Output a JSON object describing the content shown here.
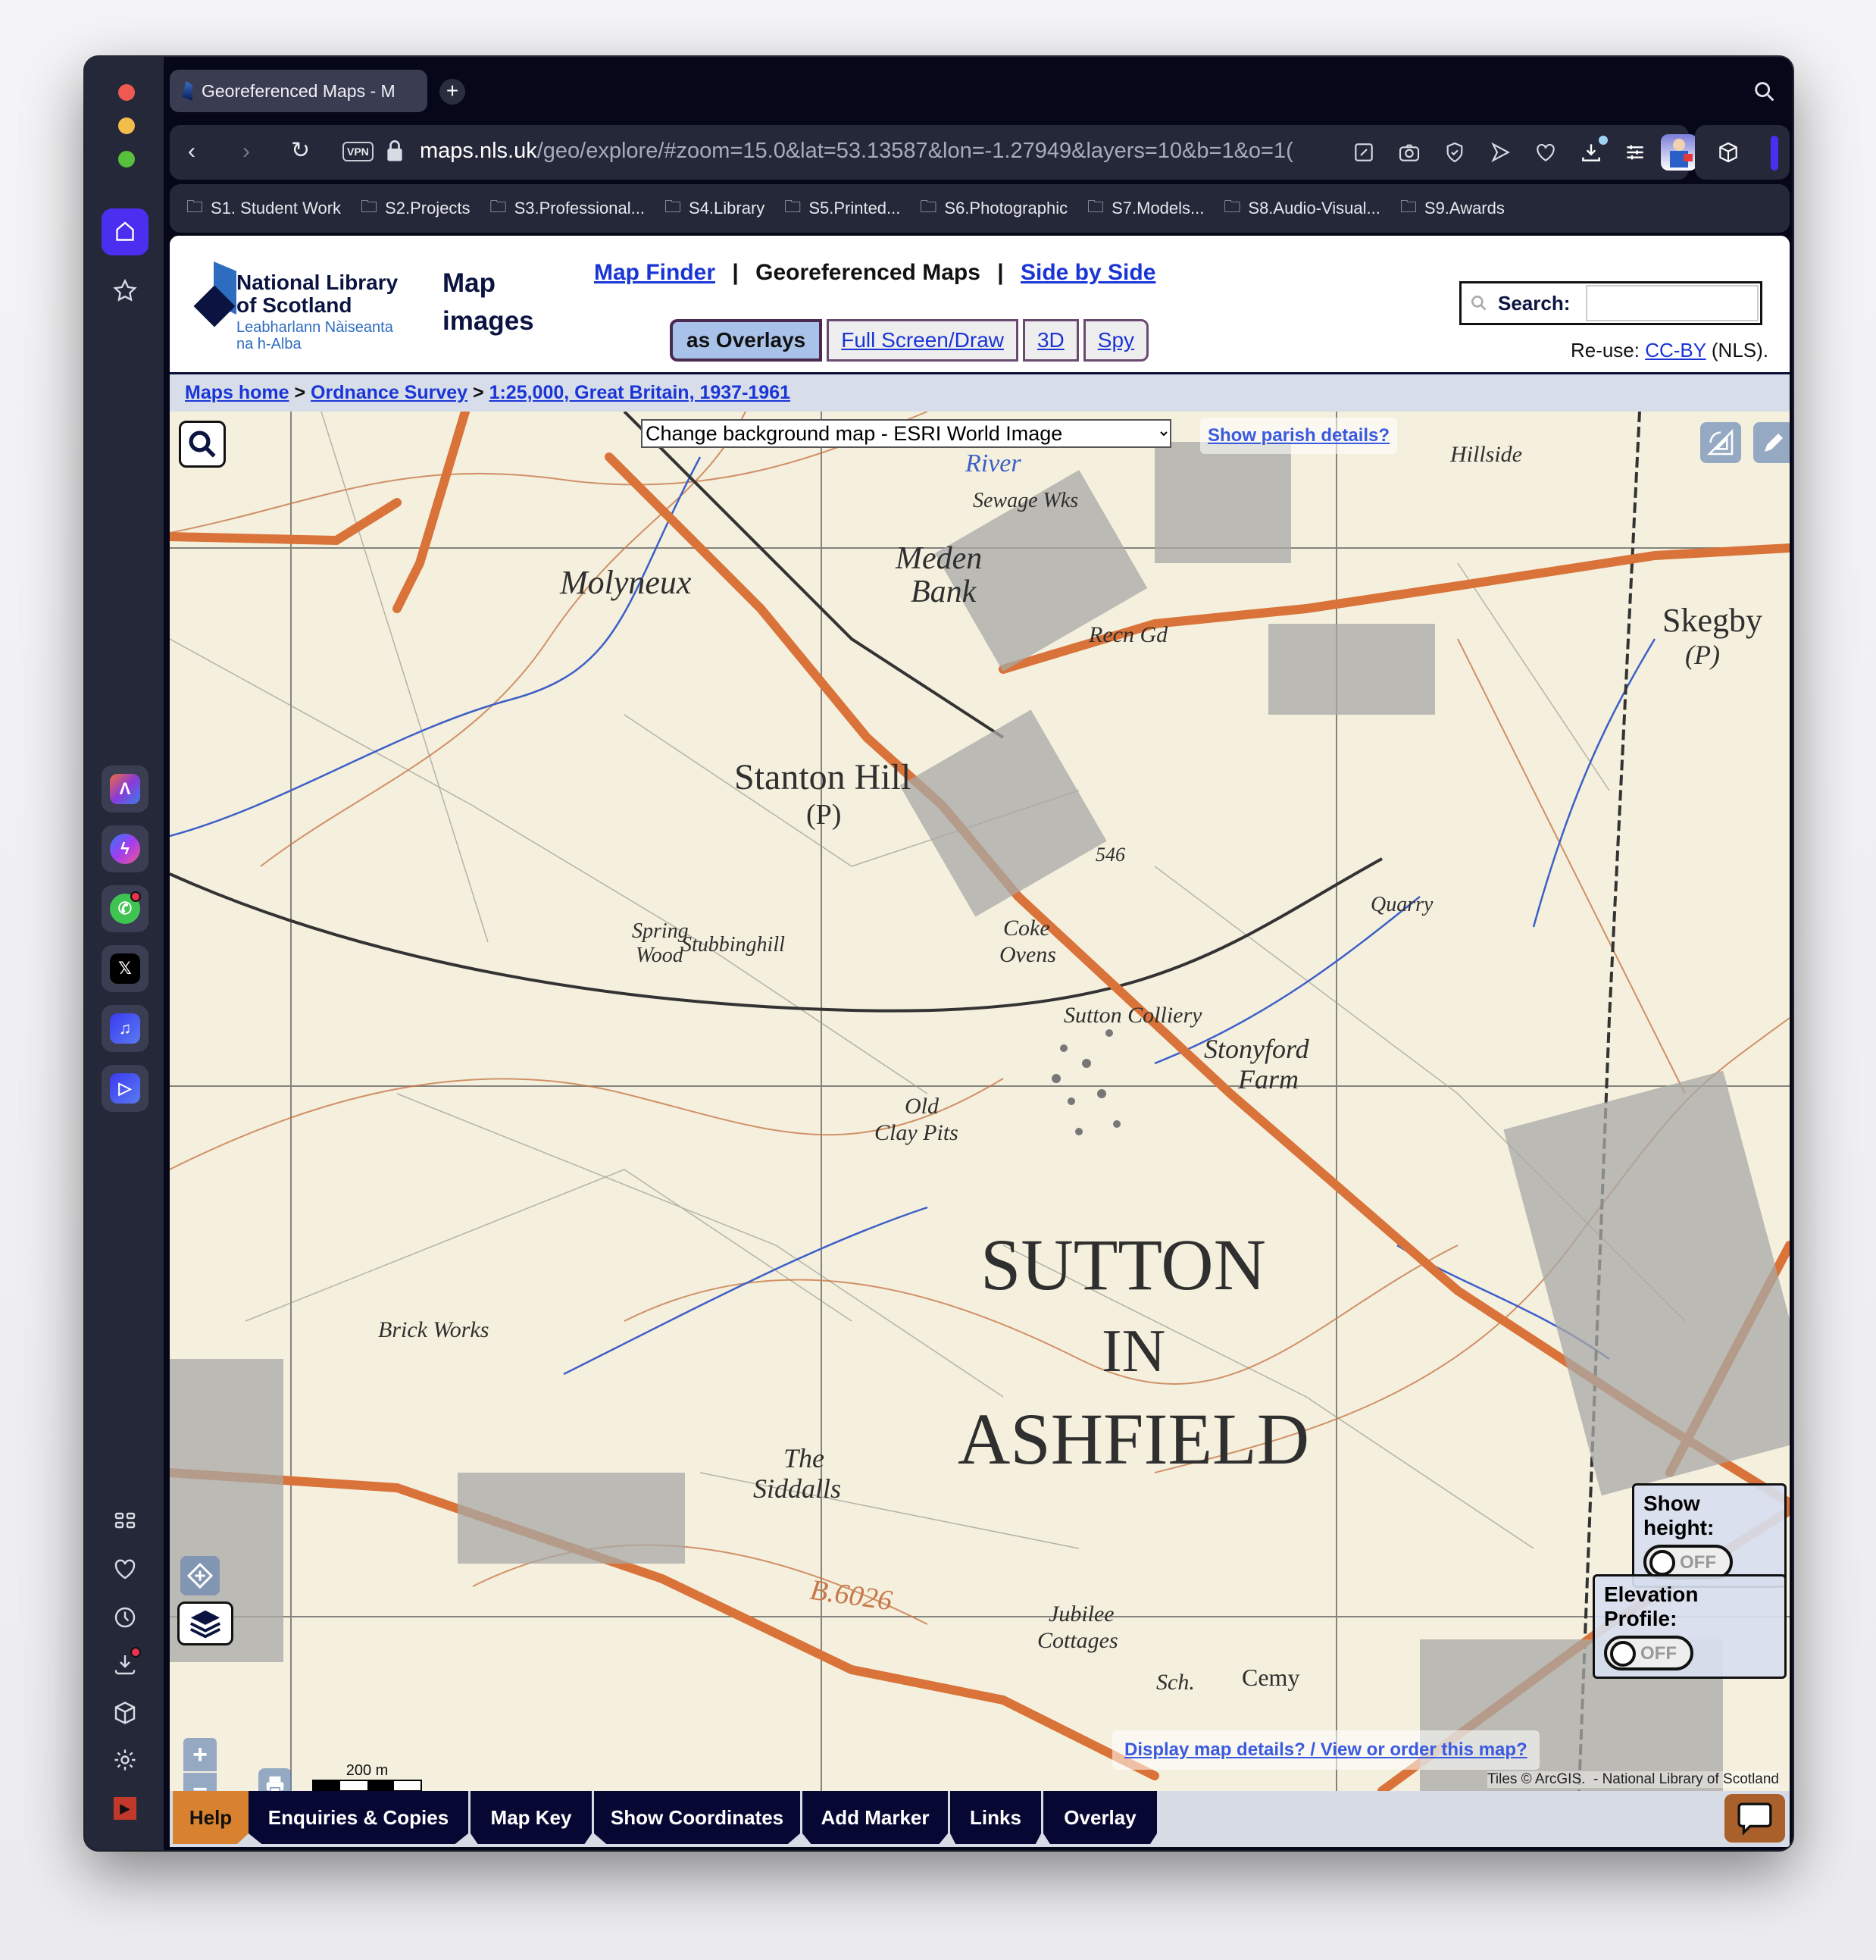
{
  "browser": {
    "tab_title": "Georeferenced Maps - M",
    "new_tab_label": "+",
    "url_host": "maps.nls.uk",
    "url_path": "/geo/explore/#zoom=15.0&lat=53.13587&lon=-1.27949&layers=10&b=1&o=1(",
    "vpn_label": "VPN",
    "toolbar_icons": [
      "edit-icon",
      "camera-icon",
      "shield-icon",
      "send-icon",
      "heart-icon",
      "download-icon",
      "settings-sliders-icon",
      "profile-avatar"
    ],
    "bookmarks": [
      "S1. Student Work",
      "S2.Projects",
      "S3.Professional...",
      "S4.Library",
      "S5.Printed...",
      "S6.Photographic",
      "S7.Models...",
      "S8.Audio-Visual...",
      "S9.Awards"
    ]
  },
  "sidebar": {
    "apps": [
      "aria",
      "messenger",
      "whatsapp",
      "x",
      "music",
      "send"
    ],
    "bottom": [
      "grid",
      "heart",
      "history",
      "downloads",
      "cube",
      "settings",
      "video-player",
      "more"
    ]
  },
  "nls": {
    "logo_line1": "National Library",
    "logo_line2": "of Scotland",
    "logo_line3": "Leabharlann Nàiseanta",
    "logo_line4": "na h-Alba",
    "section_title_1": "Map",
    "section_title_2": "images",
    "nav": {
      "map_finder": "Map Finder",
      "sep": "|",
      "georef": "Georeferenced Maps",
      "side_by_side": "Side by Side"
    },
    "view_tabs": {
      "overlays": "as Overlays",
      "fullscreen": "Full Screen/Draw",
      "three_d": "3D",
      "spy": "Spy"
    },
    "search_label": "Search:",
    "search_value": "",
    "reuse_prefix": "Re-use: ",
    "reuse_link": "CC-BY",
    "reuse_suffix": " (NLS).",
    "breadcrumb": [
      "Maps home",
      "Ordnance Survey",
      "1:25,000, Great Britain, 1937-1961"
    ],
    "breadcrumb_sep": " > "
  },
  "map": {
    "background_select": "Change background map - ESRI World Image",
    "parish_link": "Show parish details?",
    "details_link": "Display map details? / View or order this map?",
    "attribution": "Tiles © ArcGIS.  - National Library of Scotland",
    "scale_label": "200 m",
    "show_height_label": "Show height:",
    "show_height_state": "OFF",
    "elevation_label": "Elevation Profile:",
    "elevation_state": "OFF",
    "zoom_in": "+",
    "zoom_out": "−",
    "place_labels": {
      "main1": "SUTTON",
      "main2": "IN",
      "main3": "ASHFIELD",
      "stanton": "Stanton Hill",
      "stanton_p": "(P)",
      "molyneux": "Molyneux",
      "meden1": "Meden",
      "meden2": "Bank",
      "skegby": "Skegby",
      "skegby_p": "(P)",
      "siddalls1": "The",
      "siddalls2": "Siddalls",
      "brickworks": "Brick Works",
      "jubilee1": "Jubilee",
      "jubilee2": "Cottages",
      "colliery": "Sutton Colliery",
      "stonyford1": "Stonyford",
      "stonyford2": "Farm",
      "coke1": "Coke",
      "coke2": "Ovens",
      "clay1": "Old",
      "clay2": "Clay Pits",
      "spring1": "Spring",
      "spring2": "Wood",
      "stubbing": "Stubbinghill",
      "sewage": "Sewage Wks",
      "river": "River",
      "quarry": "Quarry",
      "road": "B.6026",
      "cemy": "Cemy",
      "sch": "Sch.",
      "recn": "Recn Gd",
      "hillside": "Hillside",
      "height546": "546"
    }
  },
  "bottom_bar": {
    "tabs": [
      "Help",
      "Enquiries & Copies",
      "Map Key",
      "Show Coordinates",
      "Add Marker",
      "Links",
      "Overlay"
    ]
  },
  "colors": {
    "accent": "#4a2ff0",
    "help_tab": "#d8812e",
    "nav_tab": "#060833",
    "link": "#1a35d6",
    "map_road": "#d9733a",
    "map_contour": "#c8784a",
    "map_water": "#3d5fc8"
  }
}
